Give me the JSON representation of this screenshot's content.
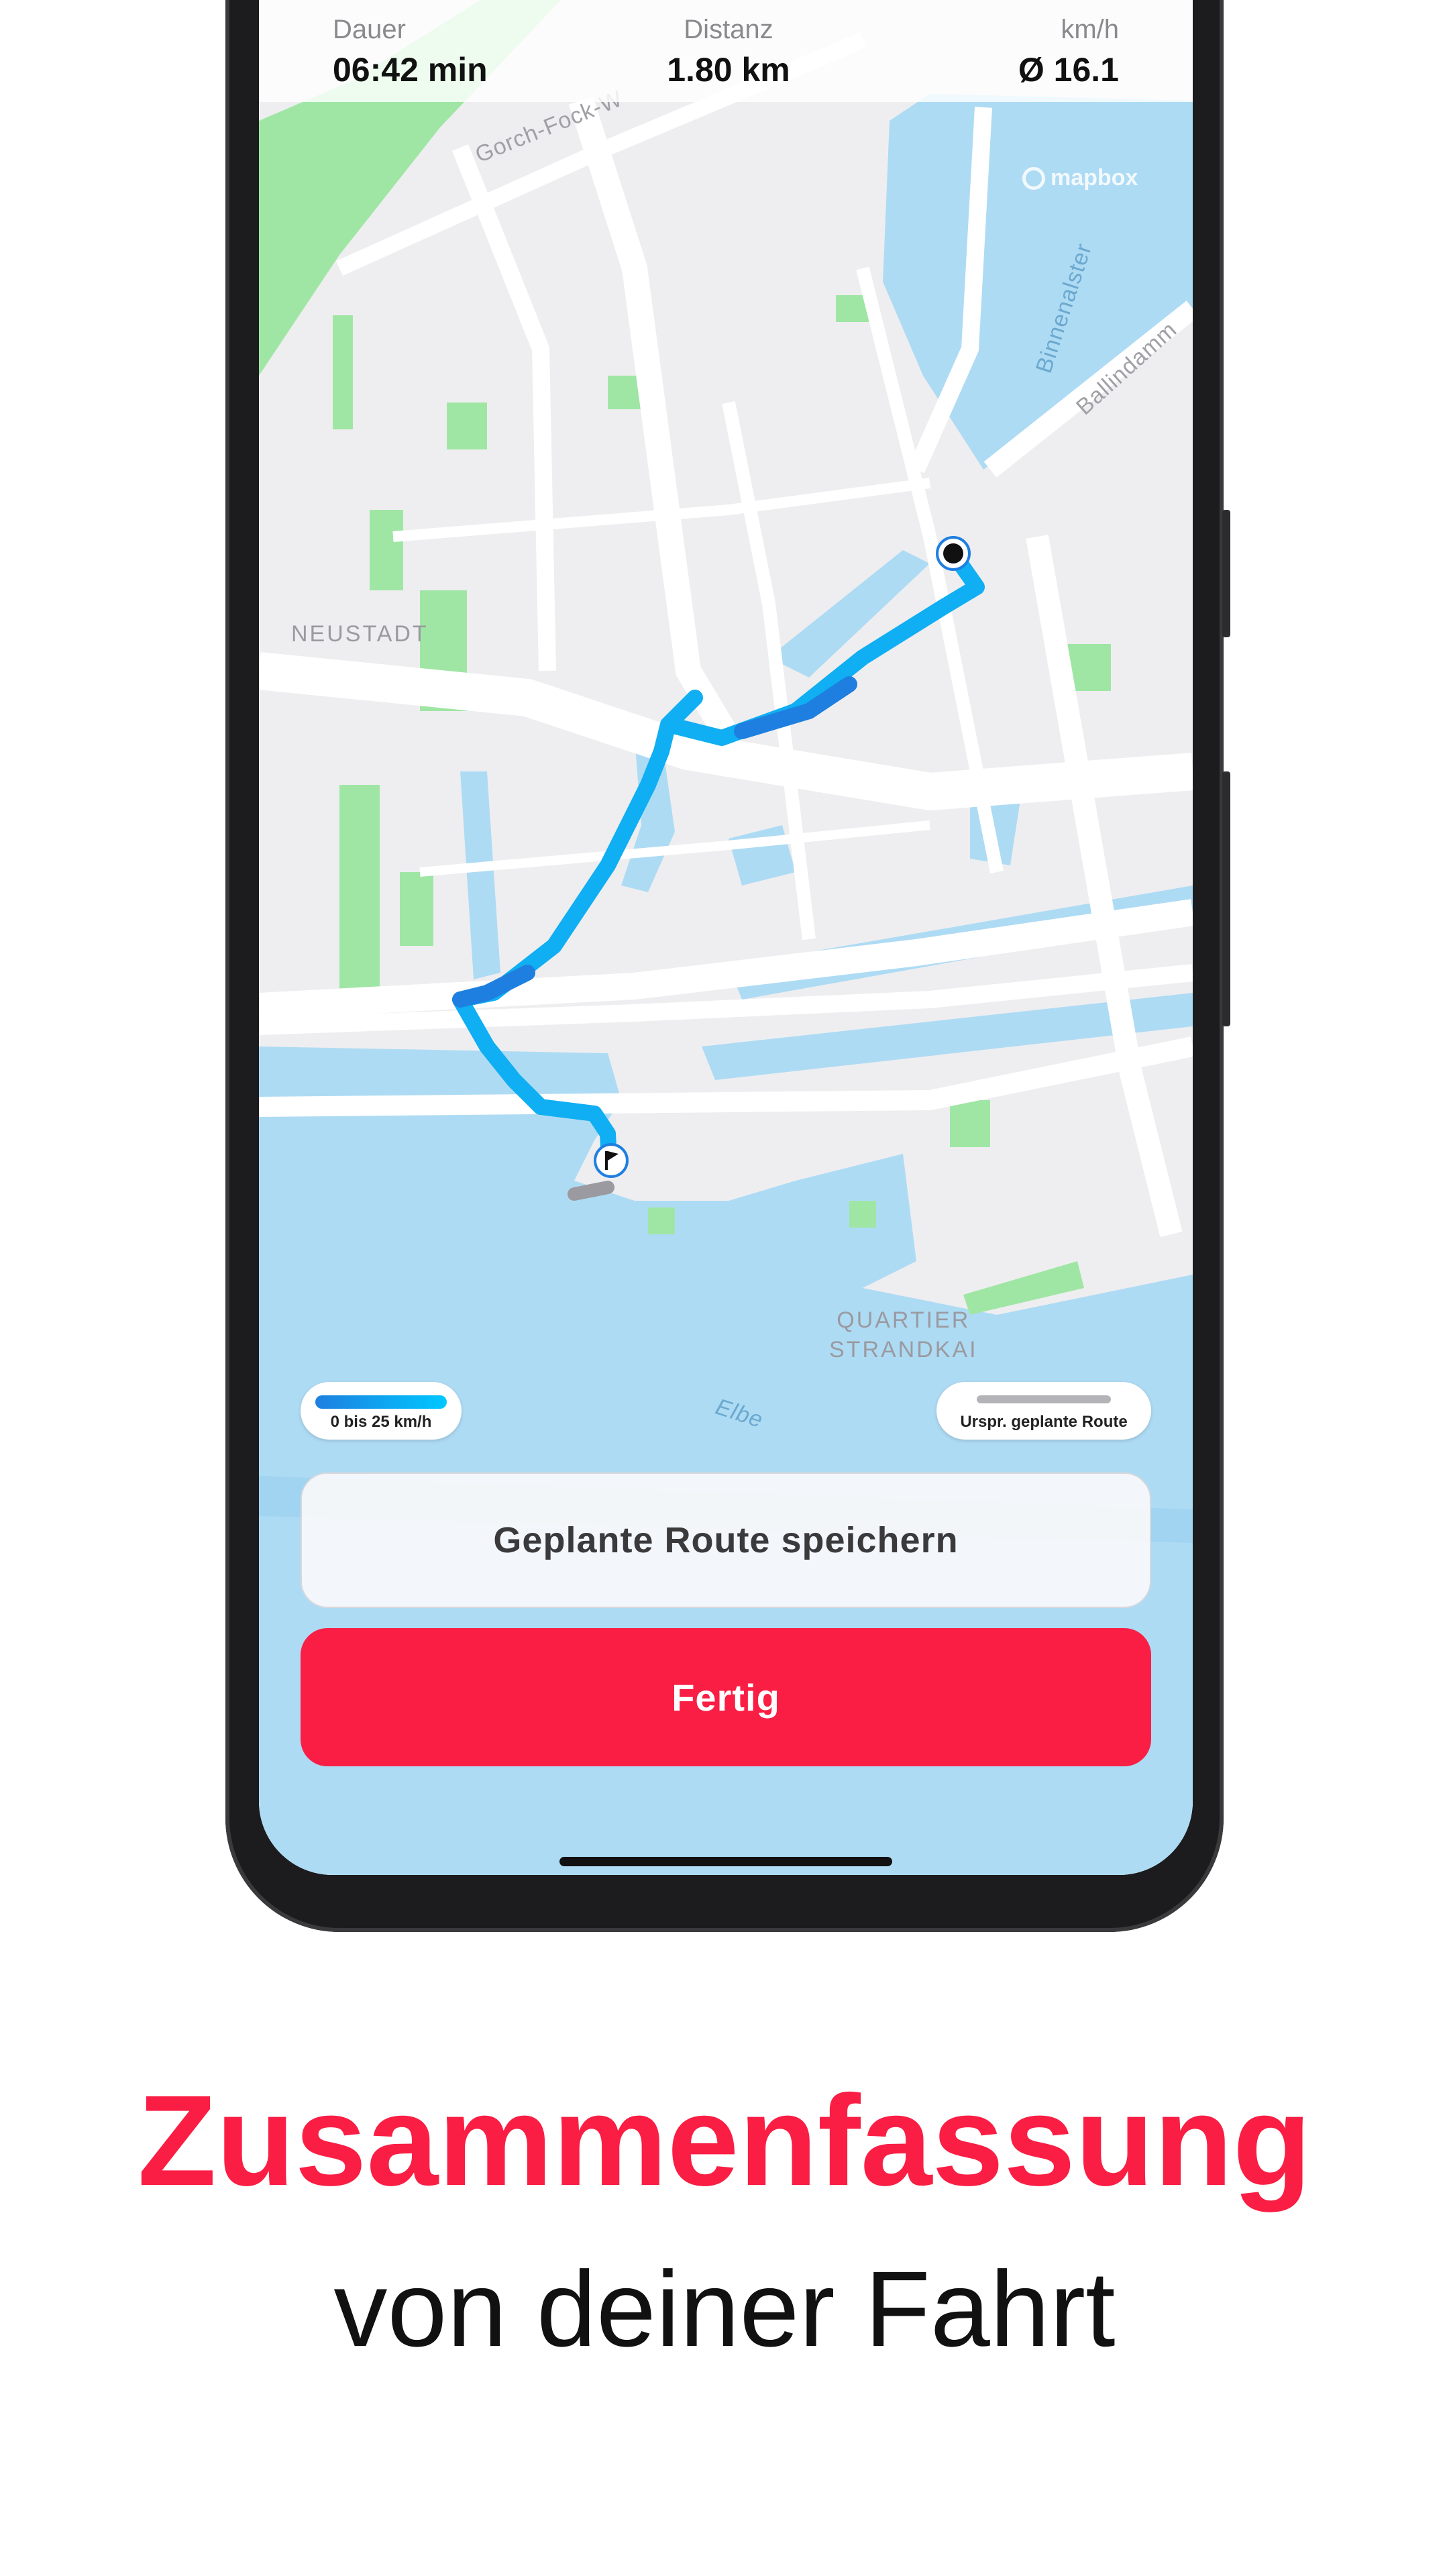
{
  "stats": {
    "duration": {
      "label": "Dauer",
      "value": "06:42 min"
    },
    "distance": {
      "label": "Distanz",
      "value": "1.80 km"
    },
    "speed": {
      "label": "km/h",
      "value": "Ø 16.1"
    }
  },
  "map": {
    "attribution": "mapbox",
    "labels": {
      "street_1": "Gorch-Fock-W",
      "lake": "Binnenalster",
      "street_2": "Ballindamm",
      "district_1": "NEUSTADT",
      "district_2_line1": "QUARTIER",
      "district_2_line2": "STRANDKAI",
      "river": "Elbe"
    }
  },
  "legend": {
    "speed": "0 bis 25 km/h",
    "planned": "Urspr. geplante Route"
  },
  "buttons": {
    "save_route": "Geplante Route speichern",
    "done": "Fertig"
  },
  "promo": {
    "headline": "Zusammenfassung",
    "subline": "von deiner Fahrt"
  },
  "colors": {
    "accent": "#fa1e44",
    "route_fast": "#00b4f5",
    "route_slow": "#1e7fe0",
    "water": "#aedbf4",
    "park": "#9fe6a4"
  }
}
